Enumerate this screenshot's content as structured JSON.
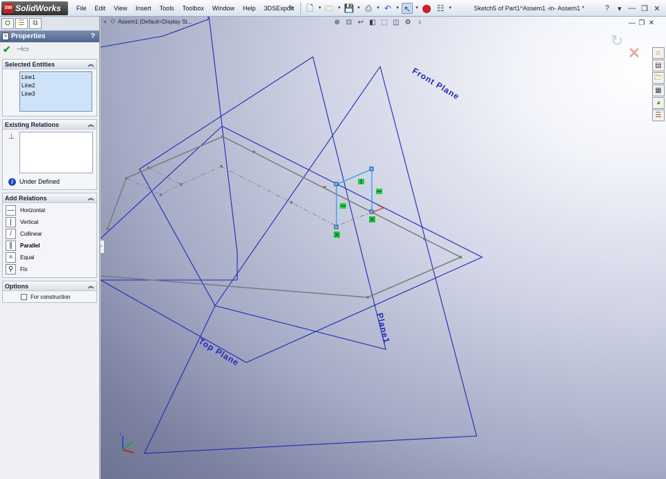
{
  "app": {
    "name": "SolidWorks",
    "logo_short": "SW"
  },
  "menu": [
    "File",
    "Edit",
    "View",
    "Insert",
    "Tools",
    "Toolbox",
    "Window",
    "Help",
    "3DSExport"
  ],
  "document_title": "Sketch5 of Part1^Assem1 -in- Assem1 *",
  "window_controls": {
    "help": "?",
    "arrow": "▾",
    "minimize": "—",
    "restore": "❐",
    "close": "✕"
  },
  "panel": {
    "header": "Properties",
    "help": "?",
    "selected_entities": {
      "title": "Selected Entities",
      "items": [
        "Line1",
        "Line2",
        "Line3"
      ]
    },
    "existing_relations": {
      "title": "Existing Relations",
      "status": "Under Defined"
    },
    "add_relations": {
      "title": "Add Relations",
      "items": [
        {
          "label": "Horizontal",
          "icon": "—"
        },
        {
          "label": "Vertical",
          "icon": "|"
        },
        {
          "label": "Collinear",
          "icon": "/"
        },
        {
          "label": "Parallel",
          "icon": "∥"
        },
        {
          "label": "Equal",
          "icon": "="
        },
        {
          "label": "Fix",
          "icon": "⚲"
        }
      ]
    },
    "options": {
      "title": "Options",
      "for_construction": "For construction"
    }
  },
  "viewport": {
    "tree_item": "Assem1  (Default<Display St...",
    "planes": {
      "front": "Front Plane",
      "top": "Top Plane",
      "plane1": "Plane1"
    }
  },
  "colors": {
    "plane": "#1c2ab4",
    "sketch": "#7a7a7a",
    "selected": "#3aa0f0",
    "relation": "#29c84a"
  }
}
